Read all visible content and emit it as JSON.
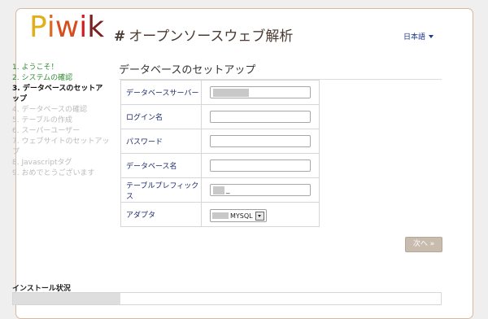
{
  "header": {
    "logo_letters": [
      "P",
      "i",
      "w",
      "i",
      "k"
    ],
    "logo_colors": [
      "#e0b01a",
      "#df6b1c",
      "#d74d1e",
      "#cf1f20",
      "#7a2220"
    ],
    "tagline_hash": "#",
    "tagline": "オープンソースウェブ解析",
    "language": "日本語"
  },
  "steps": [
    {
      "label": "1. ようこそ！",
      "state": "done"
    },
    {
      "label": "2. システムの確認",
      "state": "done"
    },
    {
      "label": "3. データベースのセットアップ",
      "state": "current"
    },
    {
      "label": "4. データベースの確認",
      "state": "todo"
    },
    {
      "label": "5. テーブルの作成",
      "state": "todo"
    },
    {
      "label": "6. スーパーユーザー",
      "state": "todo"
    },
    {
      "label": "7. ウェブサイトのセットアップ",
      "state": "todo"
    },
    {
      "label": "8. Javascriptタグ",
      "state": "todo"
    },
    {
      "label": "9. おめでとうございます",
      "state": "todo"
    }
  ],
  "form": {
    "title": "データベースのセットアップ",
    "fields": [
      {
        "label": "データベースサーバー",
        "value": ""
      },
      {
        "label": "ログイン名",
        "value": ""
      },
      {
        "label": "パスワード",
        "value": ""
      },
      {
        "label": "データベース名",
        "value": ""
      },
      {
        "label": "テーブルプレフィックス",
        "value": "_"
      }
    ],
    "adapter_label": "アダプタ",
    "adapter_value": "MYSQL"
  },
  "next_button": "次へ »",
  "install_status": {
    "title": "インストール状況",
    "progress": 0.25
  }
}
